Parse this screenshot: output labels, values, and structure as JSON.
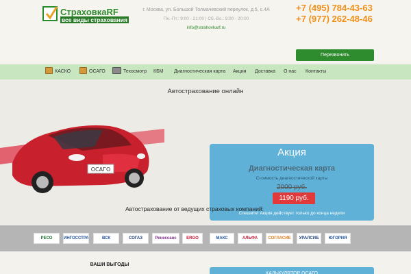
{
  "header": {
    "logo_brand": "Страховка",
    "logo_rf": "RF",
    "logo_tagline": "все виды страхования",
    "address": "г. Москва, ул. Большой Толмачевский переулок, д.5, с.4А",
    "hours": "Пн.-Пт.: 9:00 - 21:00 | Сб.-Вс.: 9:00 - 20:00",
    "email": "info@strahovkarf.ru",
    "phone_1": "+7 (495) 784-43-63",
    "phone_2": "+7 (977) 262-48-46",
    "call_button": "Перезвонить",
    "accent": "#2e8b2e",
    "phone_color": "#f0901a"
  },
  "nav": {
    "items": [
      {
        "label": "КАСКО",
        "icon": "car-icon"
      },
      {
        "label": "ОСАГО",
        "icon": "document-icon"
      },
      {
        "label": "Техосмотр",
        "icon": "wrench-icon"
      },
      {
        "label": "КБМ"
      },
      {
        "label": "Диагностическая карта"
      },
      {
        "label": "Акция"
      },
      {
        "label": "Доставка"
      },
      {
        "label": "О нас"
      },
      {
        "label": "Контакты"
      }
    ],
    "background": "#c8e6bf"
  },
  "main": {
    "title": "Автострахование онлайн",
    "car_plate": "ОСАГО",
    "tagline": "Автострахование от ведущих страховых компаний:"
  },
  "promo": {
    "heading": "Акция",
    "product": "Диагностическая карта",
    "cost_label": "Стоимость диагностической карты",
    "old_price": "2000 руб.",
    "new_price": "1190 руб.",
    "note": "Спешите! Акция действует только до конца недели",
    "background": "#5fb1d8",
    "price_color": "#e23a3a"
  },
  "partners": [
    {
      "name": "РЕСО",
      "color": "#1a6e2e"
    },
    {
      "name": "ИНГОССТРАХ",
      "color": "#1d4f9a"
    },
    {
      "name": "ВСК",
      "color": "#1d4f9a"
    },
    {
      "name": "СОГАЗ",
      "color": "#1d3f7a"
    },
    {
      "name": "Ренессанс",
      "color": "#7a2a8a"
    },
    {
      "name": "ERGO",
      "color": "#c8102e"
    },
    {
      "name": "МАКС",
      "color": "#1d4f9a"
    },
    {
      "name": "АЛЬФА",
      "color": "#c8102e"
    },
    {
      "name": "СОГЛАСИЕ",
      "color": "#e07a1a"
    },
    {
      "name": "УРАЛСИБ",
      "color": "#1d3f7a"
    },
    {
      "name": "ЮГОРИЯ",
      "color": "#1d4f9a"
    }
  ],
  "bottom": {
    "benefits_title": "ВАШИ ВЫГОДЫ",
    "calc_title": "КАЛЬКУЛЯТОР ОСАГО"
  }
}
